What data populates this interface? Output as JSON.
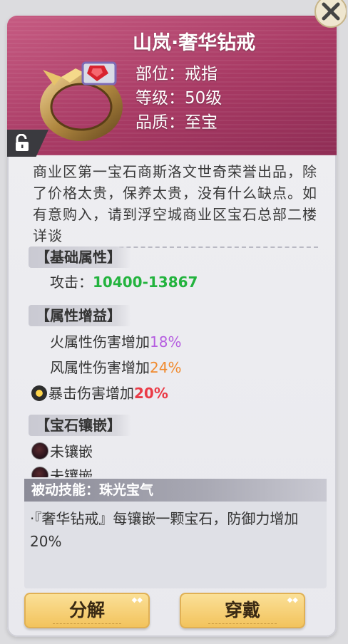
{
  "item": {
    "name": "山岚·奢华钻戒",
    "slot": "部位：戒指",
    "level": "等级：50级",
    "quality": "品质：至宝",
    "description": "商业区第一宝石商斯洛文世奇荣誉出品，除了价格太贵，保养太贵，没有什么缺点。如有意购入，请到浮空城商业区宝石总部二楼详谈"
  },
  "sections": {
    "base": {
      "label": "【基础属性】",
      "attack_label": "攻击：",
      "attack_value": "10400-13867"
    },
    "bonus": {
      "label": "【属性增益】",
      "rows": [
        {
          "label": "火属性伤害增加",
          "value": "18%"
        },
        {
          "label": "风属性伤害增加",
          "value": "24%"
        },
        {
          "label": "暴击伤害增加",
          "value": "20%"
        }
      ]
    },
    "gems": {
      "label": "【宝石镶嵌】",
      "slots": [
        "未镶嵌",
        "未镶嵌"
      ]
    }
  },
  "skill": {
    "title": "被动技能：珠光宝气",
    "text": "·『奢华钻戒』每镶嵌一颗宝石，防御力增加20%"
  },
  "buttons": {
    "decompose": "分解",
    "equip": "穿戴"
  },
  "colors": {
    "header": "#a83a64",
    "attack": "#23b33e",
    "fire": "#b55de0",
    "wind": "#f08a2e",
    "crit": "#ea3b47",
    "button": "#f2c25a"
  },
  "icons": {
    "close": "close-icon",
    "lock": "lock-icon",
    "ring": "ring-icon",
    "crit": "crit-star-icon",
    "socket": "empty-socket-icon"
  }
}
